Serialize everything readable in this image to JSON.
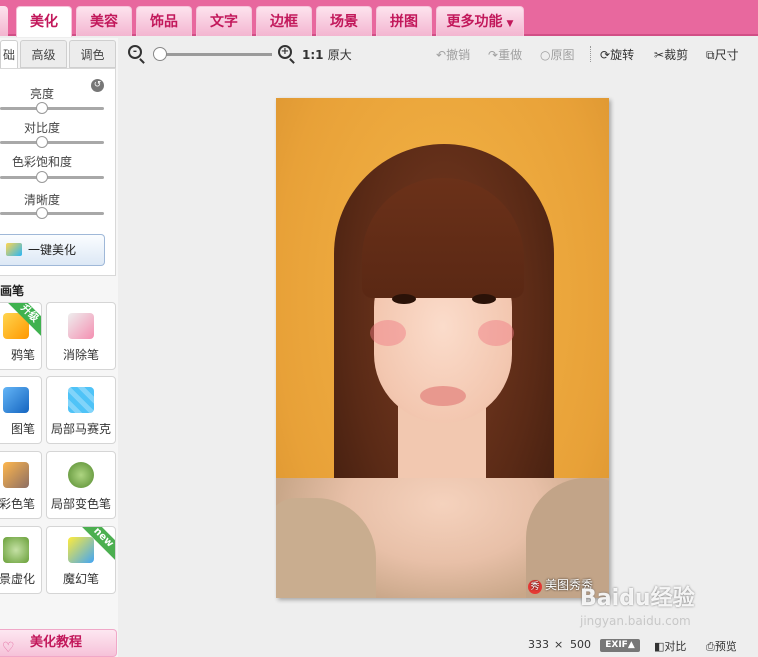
{
  "top_nav": {
    "tabs": [
      {
        "label": "美化",
        "active": true
      },
      {
        "label": "美容",
        "active": false
      },
      {
        "label": "饰品",
        "active": false
      },
      {
        "label": "文字",
        "active": false
      },
      {
        "label": "边框",
        "active": false
      },
      {
        "label": "场景",
        "active": false
      },
      {
        "label": "拼图",
        "active": false
      },
      {
        "label": "更多功能",
        "active": false,
        "has_dropdown": true
      }
    ],
    "accent_color": "#e8689e"
  },
  "left_panel": {
    "sub_tabs": [
      "础",
      "高级",
      "调色"
    ],
    "adjustments": [
      {
        "label": "亮度",
        "value": 0.4
      },
      {
        "label": "对比度",
        "value": 0.4
      },
      {
        "label": "色彩饱和度",
        "value": 0.4
      },
      {
        "label": "清晰度",
        "value": 0.4
      }
    ],
    "one_key_label": "一键美化",
    "brush_title": "画笔",
    "tools": [
      {
        "label": "鸦笔",
        "icon": "pencil-icon",
        "badge": "升级"
      },
      {
        "label": "消除笔",
        "icon": "eraser-icon",
        "badge": ""
      },
      {
        "label": "图笔",
        "icon": "pen-icon",
        "badge": ""
      },
      {
        "label": "局部马赛克",
        "icon": "mosaic-icon",
        "badge": ""
      },
      {
        "label": "彩色笔",
        "icon": "paint-brush-icon",
        "badge": ""
      },
      {
        "label": "局部变色笔",
        "icon": "color-bucket-icon",
        "badge": ""
      },
      {
        "label": "景虚化",
        "icon": "camera-icon",
        "badge": ""
      },
      {
        "label": "魔幻笔",
        "icon": "magic-wand-icon",
        "badge": "new"
      }
    ],
    "tutorial_label": "美化教程"
  },
  "toolbar": {
    "zoom_level": 0.05,
    "actual_size_prefix": "1:1",
    "actual_size_label": "原大",
    "undo_label": "撤销",
    "redo_label": "重做",
    "original_label": "原图",
    "rotate_label": "旋转",
    "crop_label": "裁剪",
    "resize_label": "尺寸"
  },
  "canvas": {
    "watermark_badge": "秀",
    "watermark_text": "美图秀秀"
  },
  "baidu_watermark": {
    "text": "Baidu经验",
    "url": "jingyan.baidu.com"
  },
  "status_bar": {
    "width": "333",
    "times": "×",
    "height": "500",
    "exif_label": "EXIF▲",
    "compare_label": "对比",
    "preview_label": "预览"
  }
}
